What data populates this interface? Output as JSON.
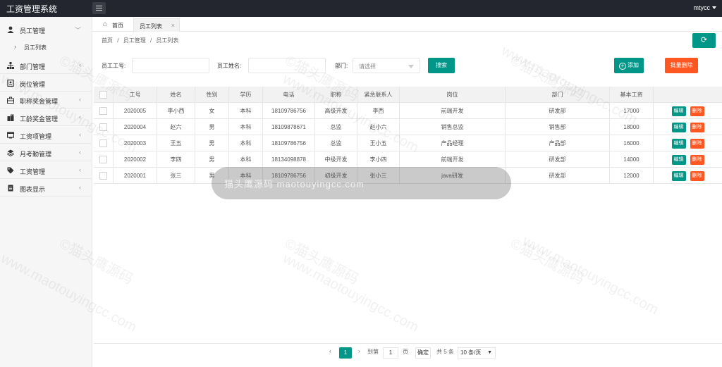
{
  "app": {
    "title": "工资管理系统",
    "user": "mtycc"
  },
  "sidebar": {
    "items": [
      {
        "label": "员工管理",
        "icon": "user-icon",
        "chevron": "﹀"
      },
      {
        "label": "部门管理",
        "icon": "org-icon",
        "chevron": "‹"
      },
      {
        "label": "岗位管理",
        "icon": "badge-icon",
        "chevron": ""
      },
      {
        "label": "职称奖金管理",
        "icon": "briefcase-icon",
        "chevron": "‹"
      },
      {
        "label": "工龄奖金管理",
        "icon": "building-icon",
        "chevron": "‹"
      },
      {
        "label": "工资项管理",
        "icon": "window-icon",
        "chevron": "‹"
      },
      {
        "label": "月考勤管理",
        "icon": "layers-icon",
        "chevron": "‹"
      },
      {
        "label": "工资管理",
        "icon": "tag-icon",
        "chevron": "‹"
      },
      {
        "label": "图表显示",
        "icon": "document-icon",
        "chevron": "‹"
      }
    ],
    "subitem": {
      "label": "员工列表"
    }
  },
  "tabs": {
    "home": "首页",
    "active": "员工列表"
  },
  "breadcrumb": {
    "c1": "首页",
    "sep": "/",
    "c2": "员工管理",
    "c3": "员工列表"
  },
  "search": {
    "id_label": "员工工号:",
    "name_label": "员工姓名:",
    "dept_label": "部门:",
    "dept_placeholder": "请选择",
    "search_btn": "搜索",
    "add_btn": "添加",
    "batch_delete_btn": "批量删除"
  },
  "table": {
    "columns": [
      "工号",
      "姓名",
      "性别",
      "学历",
      "电话",
      "职称",
      "紧急联系人",
      "岗位",
      "部门",
      "基本工资"
    ],
    "rows": [
      [
        "2020005",
        "李小西",
        "女",
        "本科",
        "18109786756",
        "高级开发",
        "李西",
        "前端开发",
        "研发部",
        "17000"
      ],
      [
        "2020004",
        "赵六",
        "男",
        "本科",
        "18109878671",
        "总监",
        "赵小六",
        "销售总监",
        "销售部",
        "18000"
      ],
      [
        "2020003",
        "王五",
        "男",
        "本科",
        "18109786756",
        "总监",
        "王小五",
        "产品经理",
        "产品部",
        "16000"
      ],
      [
        "2020002",
        "李四",
        "男",
        "本科",
        "18134098878",
        "中级开发",
        "李小四",
        "前端开发",
        "研发部",
        "14000"
      ],
      [
        "2020001",
        "张三",
        "男",
        "本科",
        "18109786756",
        "初级开发",
        "张小三",
        "java研发",
        "研发部",
        "12000"
      ]
    ],
    "edit_label": "编辑",
    "delete_label": "删除"
  },
  "overlay": {
    "text": "猫头鹰源码 maotouyingcc.com"
  },
  "pagination": {
    "prev": "‹",
    "current": "1",
    "next": "›",
    "goto_label": "到第",
    "page_input": "1",
    "page_unit": "页",
    "confirm": "确定",
    "total": "共 5 条",
    "page_size": "10 条/页"
  },
  "watermark": {
    "cn": "©猫头鹰源码",
    "en": "www.maotouyingcc.com"
  },
  "colors": {
    "primary": "#009688",
    "danger": "#ff5722",
    "topbar": "#23262e"
  }
}
